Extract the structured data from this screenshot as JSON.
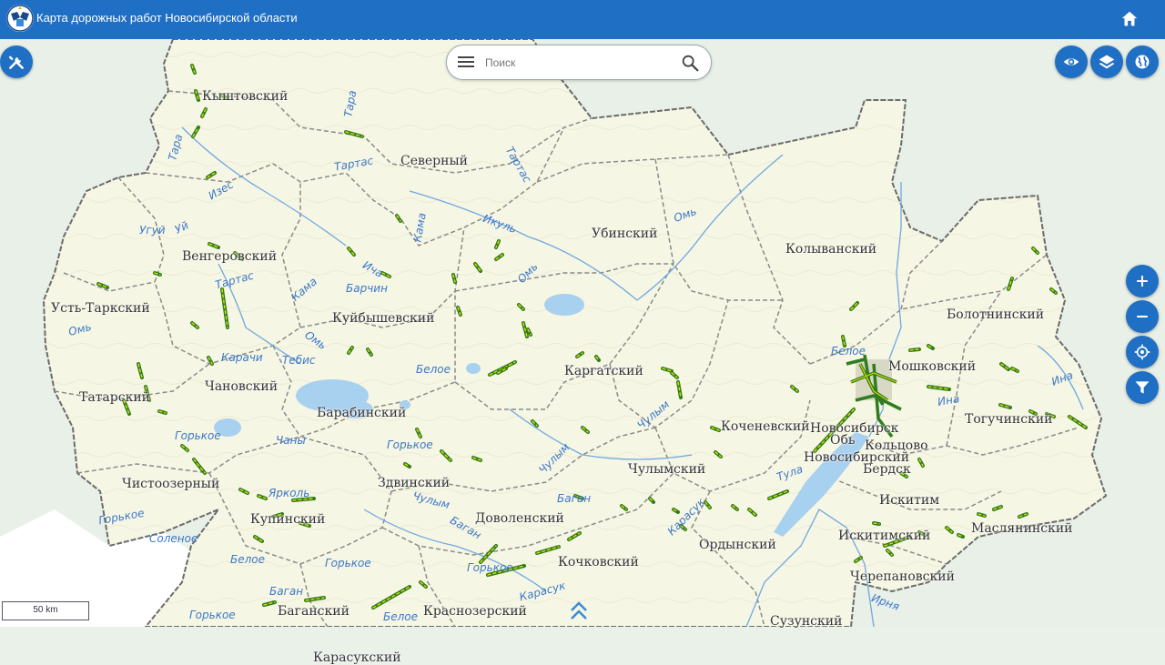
{
  "header": {
    "title": "Карта дорожных работ Новосибирской области",
    "home_icon": "home-icon"
  },
  "search": {
    "placeholder": "Поиск"
  },
  "colors": {
    "accent": "#1f6fc4",
    "road": "#2e7d1e",
    "road_alt": "#e6e000",
    "region": "#f6f6e4",
    "water": "#a8d0ef"
  },
  "scale": {
    "label": "50 km"
  },
  "districts": [
    {
      "name": "Кыштовский"
    },
    {
      "name": "Северный"
    },
    {
      "name": "Убинский"
    },
    {
      "name": "Колыванский"
    },
    {
      "name": "Венгеровский"
    },
    {
      "name": "Усть-Таркский"
    },
    {
      "name": "Куйбышевский"
    },
    {
      "name": "Болотнинский"
    },
    {
      "name": "Мошковский"
    },
    {
      "name": "Татарский"
    },
    {
      "name": "Чановский"
    },
    {
      "name": "Каргатский"
    },
    {
      "name": "Барабинский"
    },
    {
      "name": "Коченевский"
    },
    {
      "name": "Тогучинский"
    },
    {
      "name": "Чистоозерный"
    },
    {
      "name": "Здвинский"
    },
    {
      "name": "Чулымский"
    },
    {
      "name": "Купинский"
    },
    {
      "name": "Доволенский"
    },
    {
      "name": "Искитимский"
    },
    {
      "name": "Маслянинский"
    },
    {
      "name": "Ордынский"
    },
    {
      "name": "Кочковский"
    },
    {
      "name": "Черепановский"
    },
    {
      "name": "Баганский"
    },
    {
      "name": "Краснозерский"
    },
    {
      "name": "Сузунский"
    },
    {
      "name": "Карасукский"
    }
  ],
  "cities": [
    {
      "name": "Новосибирск"
    },
    {
      "name": "Обь"
    },
    {
      "name": "Кольцово"
    },
    {
      "name": "Новосибирский"
    },
    {
      "name": "Бердск"
    },
    {
      "name": "Искитим"
    }
  ],
  "water": [
    {
      "name": "Тара"
    },
    {
      "name": "Тара"
    },
    {
      "name": "Тартас"
    },
    {
      "name": "Тартас"
    },
    {
      "name": "Тартас"
    },
    {
      "name": "Изес"
    },
    {
      "name": "Угуй"
    },
    {
      "name": "Уй"
    },
    {
      "name": "Омь"
    },
    {
      "name": "Омь"
    },
    {
      "name": "Икуль"
    },
    {
      "name": "Кама"
    },
    {
      "name": "Ича"
    },
    {
      "name": "Барчин"
    },
    {
      "name": "Кама"
    },
    {
      "name": "Омь"
    },
    {
      "name": "Тебис"
    },
    {
      "name": "Карачи"
    },
    {
      "name": "Белое"
    },
    {
      "name": "Омь"
    },
    {
      "name": "Горькое"
    },
    {
      "name": "Чаны"
    },
    {
      "name": "Горькое"
    },
    {
      "name": "Ярколь"
    },
    {
      "name": "Горькое"
    },
    {
      "name": "Соленое"
    },
    {
      "name": "Белое"
    },
    {
      "name": "Горькое"
    },
    {
      "name": "Чулым"
    },
    {
      "name": "Баган"
    },
    {
      "name": "Баган"
    },
    {
      "name": "Чулым"
    },
    {
      "name": "Баган"
    },
    {
      "name": "Карасук"
    },
    {
      "name": "Горькое"
    },
    {
      "name": "Горькое"
    },
    {
      "name": "Карасук"
    },
    {
      "name": "Белое"
    },
    {
      "name": "Белое"
    },
    {
      "name": "Чулым"
    },
    {
      "name": "Ина"
    },
    {
      "name": "Ина"
    },
    {
      "name": "Ирня"
    },
    {
      "name": "Тула"
    }
  ],
  "controls": {
    "tools": "tools-icon",
    "visibility": "eye-icon",
    "layers": "layers-icon",
    "basemap": "globe-icon",
    "zoom_in": "plus-icon",
    "zoom_out": "minus-icon",
    "locate": "crosshair-icon",
    "filter": "filter-icon",
    "expand": "chevron-up-icon"
  }
}
